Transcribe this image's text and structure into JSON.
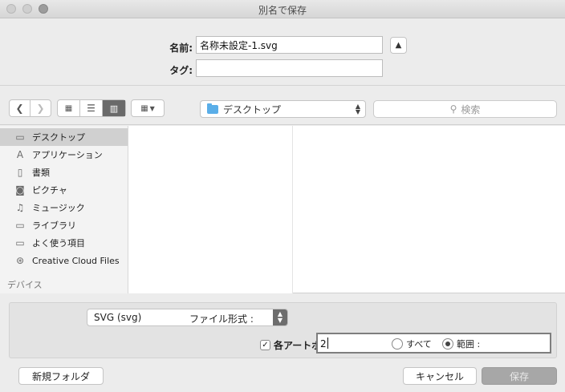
{
  "window": {
    "title": "別名で保存"
  },
  "form": {
    "name_label": "名前:",
    "name_value": "名称未設定-1.svg",
    "tag_label": "タグ:",
    "tag_value": ""
  },
  "toolbar": {
    "location": "デスクトップ",
    "search_placeholder": "検索",
    "search_icon": "magnifier-icon"
  },
  "sidebar": {
    "items": [
      {
        "label": "デスクトップ",
        "icon": "desktop-icon",
        "selected": true
      },
      {
        "label": "アプリケーション",
        "icon": "applications-icon",
        "selected": false
      },
      {
        "label": "書類",
        "icon": "documents-icon",
        "selected": false
      },
      {
        "label": "ピクチャ",
        "icon": "camera-icon",
        "selected": false
      },
      {
        "label": "ミュージック",
        "icon": "music-note-icon",
        "selected": false
      },
      {
        "label": "ライブラリ",
        "icon": "folder-icon",
        "selected": false
      },
      {
        "label": "よく使う項目",
        "icon": "folder-icon",
        "selected": false
      },
      {
        "label": "Creative Cloud Files",
        "icon": "creative-cloud-icon",
        "selected": false
      }
    ],
    "section_devices": "デバイス"
  },
  "accessory": {
    "format_value": "SVG (svg)",
    "format_label": "ファイル形式 :",
    "artboard_checkbox_label": "各アートボ",
    "artboard_checked": true,
    "range_value": "2",
    "radio_all_label": "すべて",
    "radio_range_label": "範囲 :",
    "radio_selected": "range"
  },
  "buttons": {
    "new_folder": "新規フォルダ",
    "cancel": "キャンセル",
    "save": "保存"
  }
}
